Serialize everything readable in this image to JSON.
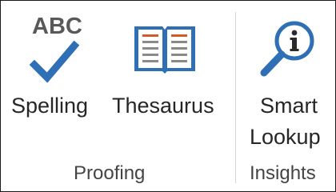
{
  "ribbon": {
    "groups": [
      {
        "label": "Proofing",
        "commands": [
          {
            "label": "Spelling",
            "icon": "spelling-check-icon",
            "icon_text": "ABC"
          },
          {
            "label": "Thesaurus",
            "icon": "book-icon"
          }
        ]
      },
      {
        "label": "Insights",
        "commands": [
          {
            "label_line1": "Smart",
            "label_line2": "Lookup",
            "icon": "magnifier-info-icon"
          }
        ]
      }
    ]
  },
  "colors": {
    "checkmark": "#2e6fb6",
    "book_cover": "#2e6fb6",
    "book_lines": "#d35b2a",
    "magnifier": "#2e6fb6",
    "text": "#262626"
  }
}
